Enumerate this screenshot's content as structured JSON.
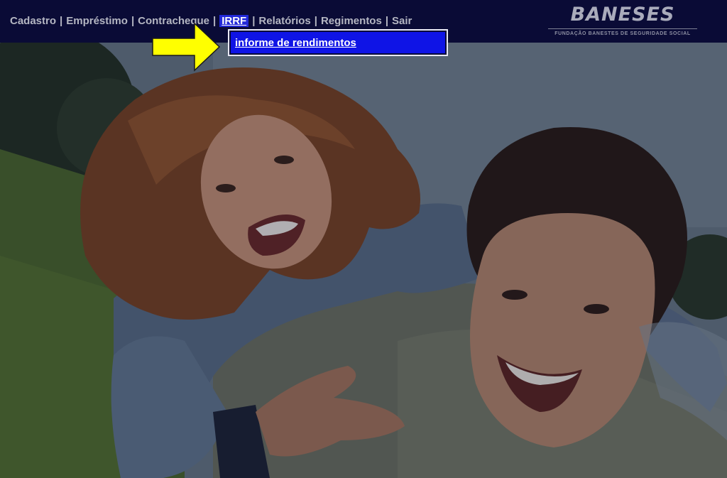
{
  "nav": {
    "items": [
      {
        "label": "Cadastro"
      },
      {
        "label": "Empréstimo"
      },
      {
        "label": "Contracheque"
      },
      {
        "label": "IRRF"
      },
      {
        "label": "Relatórios"
      },
      {
        "label": "Regimentos"
      },
      {
        "label": "Sair"
      }
    ],
    "separator": "|",
    "active_index": 3
  },
  "dropdown": {
    "items": [
      {
        "label": "informe de rendimentos"
      }
    ]
  },
  "logo": {
    "name": "BANESES",
    "tagline": "FUNDAÇÃO BANESTES DE SEGURIDADE SOCIAL"
  },
  "colors": {
    "nav_background": "#0a0b36",
    "nav_text": "#b4b6c2",
    "active_highlight": "#2229d8",
    "dropdown_item": "#0f14e6",
    "arrow": "#ffff00"
  },
  "icons": {
    "pointer": "arrow-right-icon"
  }
}
